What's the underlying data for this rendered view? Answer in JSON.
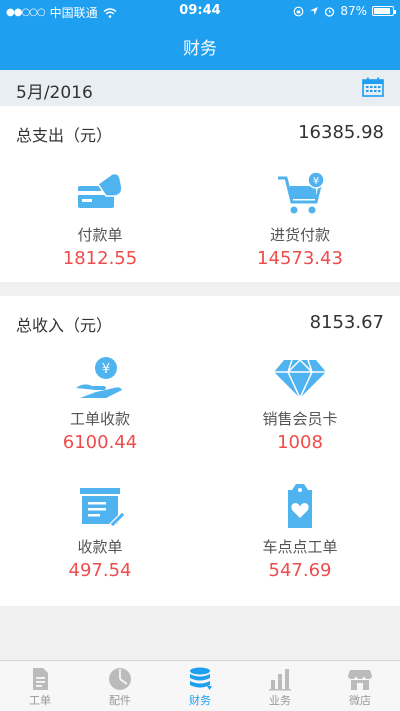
{
  "status": {
    "carrier": "中国联通",
    "time": "09:44",
    "battery": "87%",
    "battery_level": 0.87
  },
  "nav": {
    "title": "财务"
  },
  "month": {
    "label": "5月/2016"
  },
  "expense": {
    "label": "总支出（元）",
    "total": "16385.98",
    "items": [
      {
        "name": "付款单",
        "value": "1812.55",
        "icon": "card-payment-icon"
      },
      {
        "name": "进货付款",
        "value": "14573.43",
        "icon": "cart-yen-icon"
      }
    ]
  },
  "income": {
    "label": "总收入（元）",
    "total": "8153.67",
    "items": [
      {
        "name": "工单收款",
        "value": "6100.44",
        "icon": "hand-yen-icon"
      },
      {
        "name": "销售会员卡",
        "value": "1008",
        "icon": "diamond-icon"
      },
      {
        "name": "收款单",
        "value": "497.54",
        "icon": "receipt-box-icon"
      },
      {
        "name": "车点点工单",
        "value": "547.69",
        "icon": "heart-tag-icon"
      }
    ]
  },
  "tabs": [
    {
      "label": "工单",
      "icon": "document-icon"
    },
    {
      "label": "配件",
      "icon": "clock-pie-icon"
    },
    {
      "label": "财务",
      "icon": "coin-stack-icon",
      "active": true
    },
    {
      "label": "业务",
      "icon": "bar-chart-icon"
    },
    {
      "label": "微店",
      "icon": "shop-icon"
    }
  ],
  "colors": {
    "primary": "#1e9ff0",
    "value_red": "#ef4c4c",
    "icon_blue": "#4fb3f0"
  }
}
